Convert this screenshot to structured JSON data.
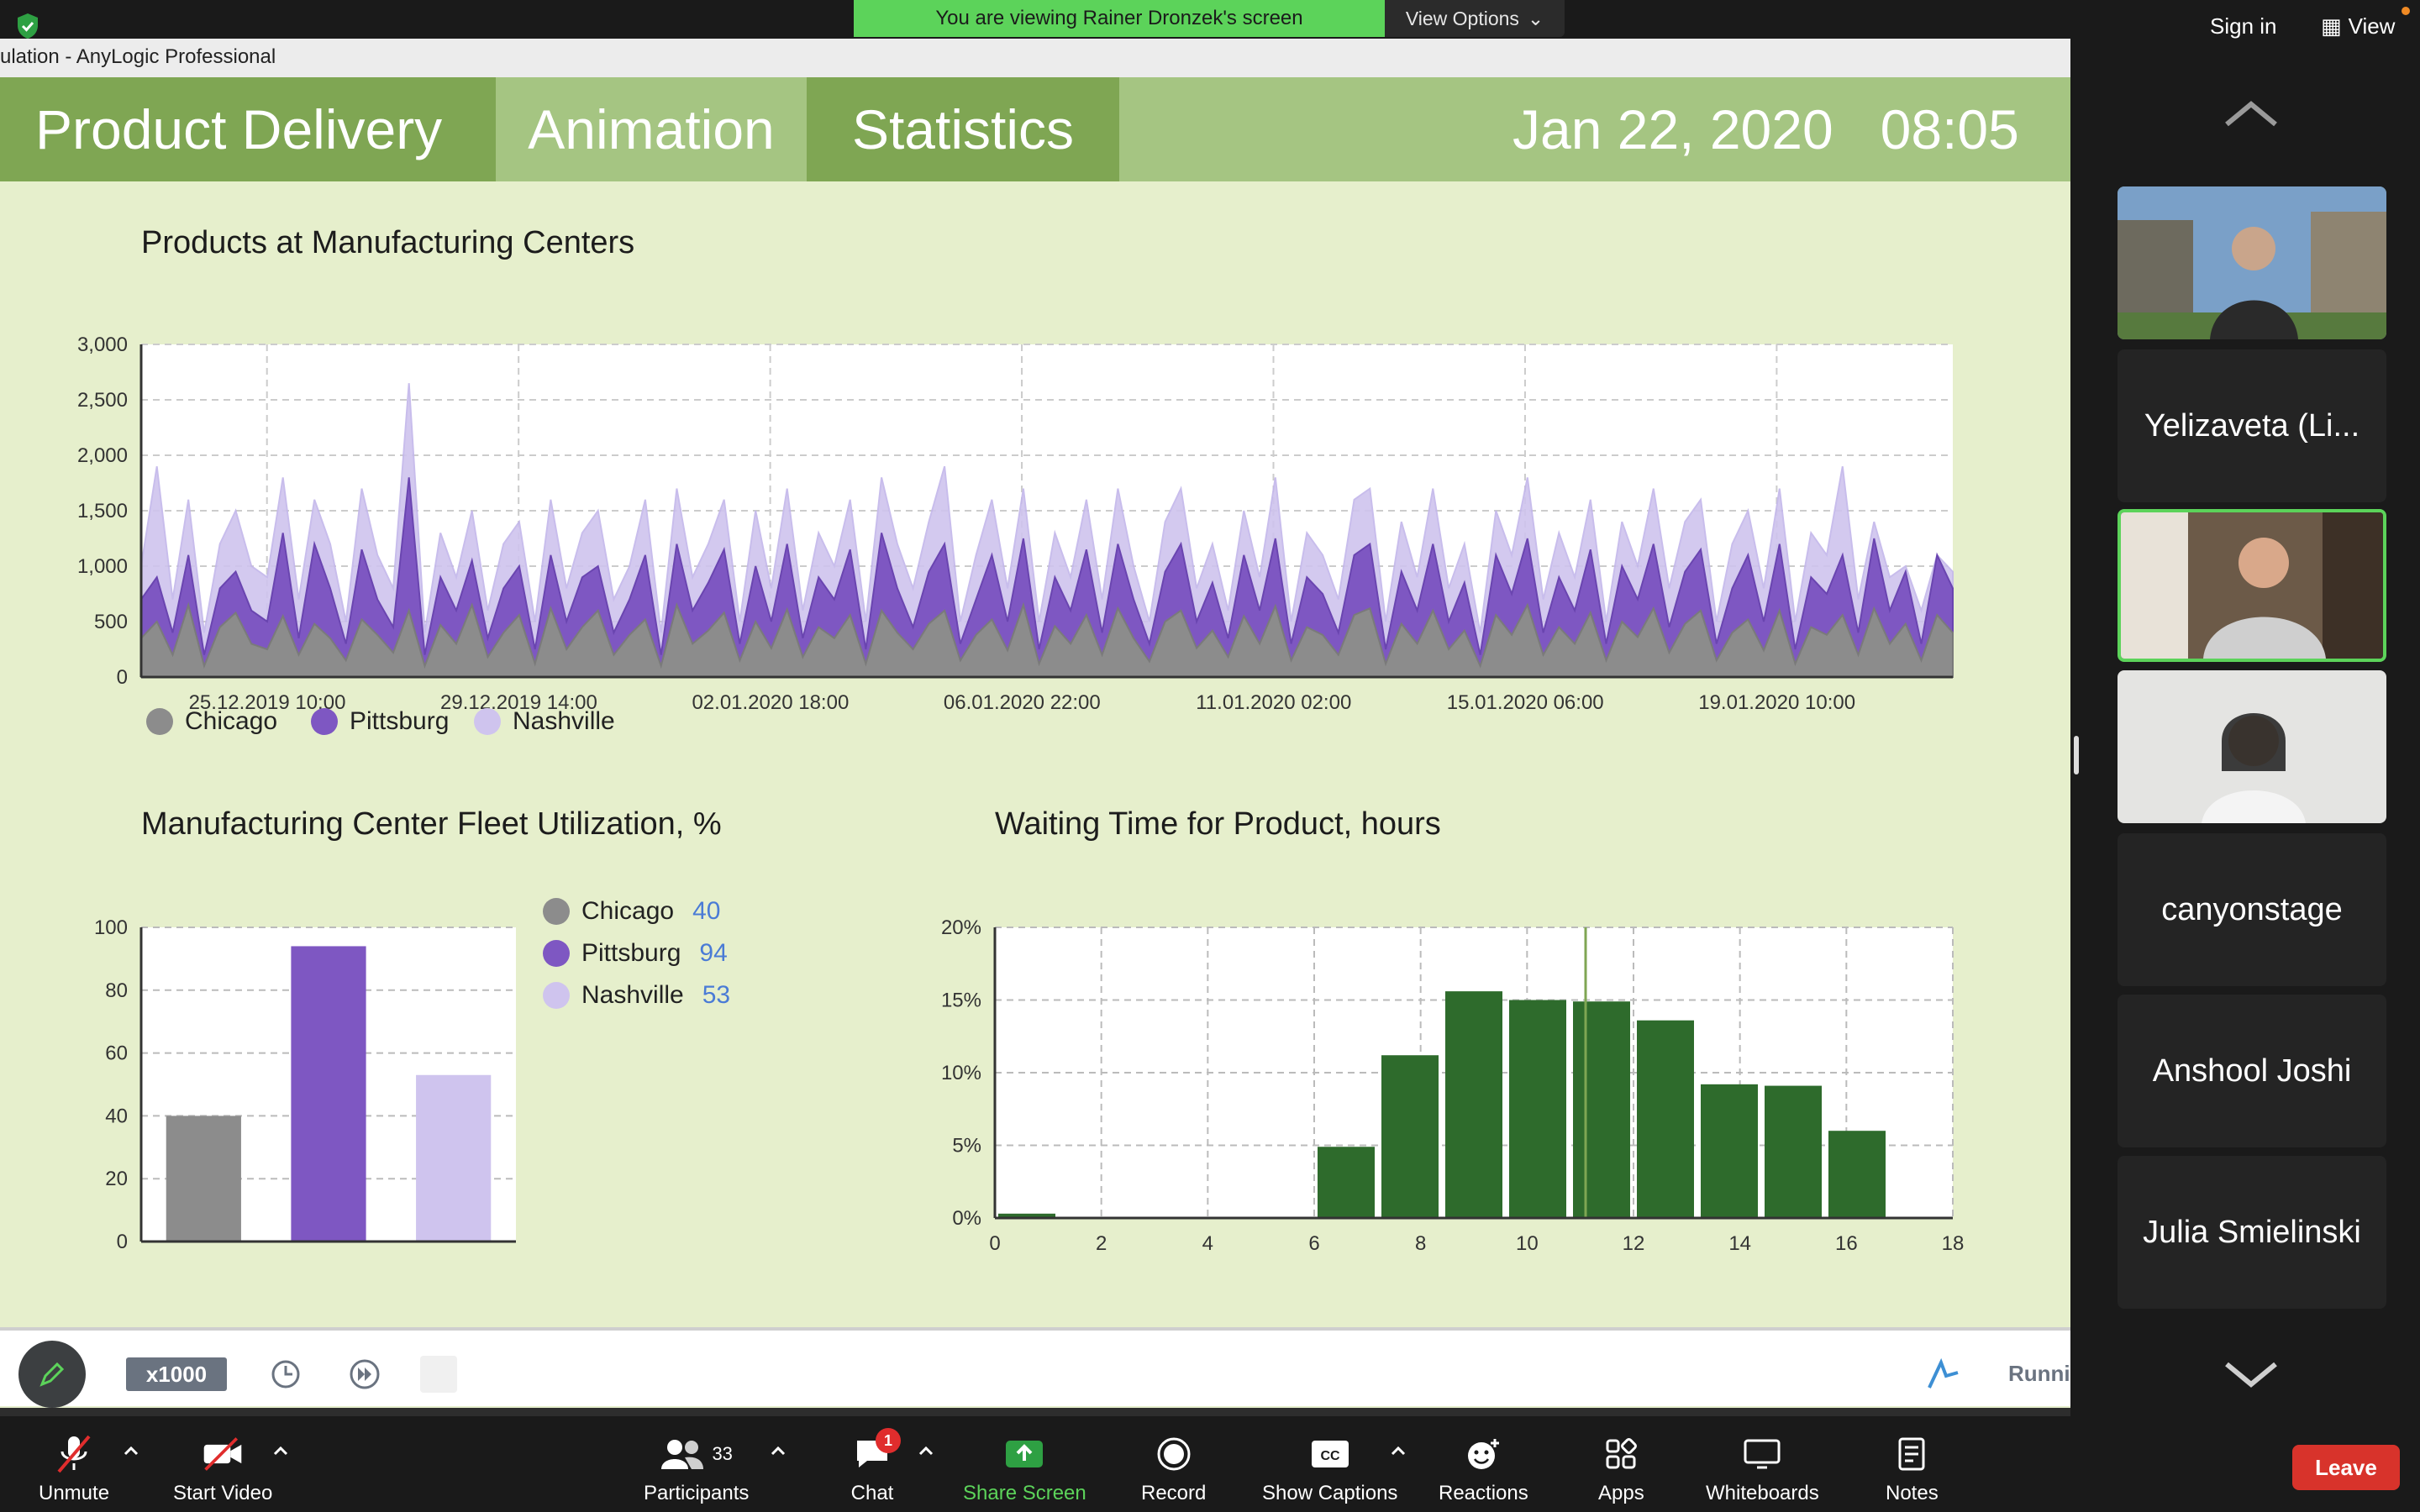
{
  "zoom_top": {
    "banner_text": "You are viewing Rainer Dronzek's screen",
    "view_options_label": "View Options",
    "sign_in_label": "Sign in",
    "view_label": "View"
  },
  "app": {
    "window_title": "ulation - AnyLogic Professional",
    "header": {
      "tabs": [
        "Product Delivery",
        "Animation",
        "Statistics"
      ],
      "date": "Jan 22, 2020",
      "time": "08:05"
    },
    "toolbar": {
      "speed_label": "x1000",
      "status_label": "Runni"
    }
  },
  "chart_data": [
    {
      "type": "area",
      "title": "Products at Manufacturing Centers",
      "xlabel": "",
      "ylabel": "",
      "ylim": [
        0,
        3000
      ],
      "yticks": [
        "0",
        "500",
        "1,000",
        "1,500",
        "2,000",
        "2,500",
        "3,000"
      ],
      "xtick_labels": [
        "25.12.2019 10:00",
        "29.12.2019 14:00",
        "02.01.2020 18:00",
        "06.01.2020 22:00",
        "11.01.2020 02:00",
        "15.01.2020 06:00",
        "19.01.2020 10:00"
      ],
      "grid": true,
      "legend_position": "bottom-left",
      "series": [
        {
          "name": "Chicago",
          "color": "#8c8c8c",
          "values": [
            350,
            500,
            200,
            650,
            100,
            450,
            580,
            300,
            250,
            550,
            200,
            480,
            350,
            150,
            520,
            380,
            220,
            600,
            100,
            470,
            300,
            650,
            180,
            400,
            560,
            120,
            620,
            250,
            450,
            600,
            200,
            380,
            520,
            100,
            650,
            300,
            420,
            580,
            150,
            500,
            260,
            610,
            180,
            450,
            350,
            560,
            120,
            600,
            400,
            250,
            480,
            600,
            150,
            380,
            520,
            240,
            650,
            120,
            460,
            300,
            560,
            200,
            620,
            350,
            140,
            500,
            600,
            260,
            420,
            180,
            550,
            300,
            640,
            150,
            450,
            380,
            200,
            560,
            620,
            120,
            480,
            300,
            600,
            250,
            420,
            100,
            560,
            380,
            650,
            200,
            450,
            300,
            580,
            150,
            500,
            360,
            620,
            220,
            480,
            600,
            150,
            400,
            520,
            240,
            600,
            120,
            450,
            380,
            560,
            200,
            620,
            300,
            480,
            150,
            560,
            400
          ]
        },
        {
          "name": "Pittsburg",
          "color": "#7e57c2",
          "values": [
            700,
            900,
            400,
            1100,
            200,
            800,
            950,
            600,
            500,
            1300,
            350,
            1200,
            800,
            300,
            1150,
            700,
            450,
            1800,
            200,
            900,
            600,
            1050,
            350,
            800,
            1000,
            250,
            1100,
            500,
            900,
            1000,
            400,
            700,
            1100,
            200,
            1200,
            600,
            850,
            1150,
            300,
            1000,
            500,
            1200,
            350,
            900,
            700,
            1150,
            250,
            1300,
            800,
            450,
            950,
            1200,
            300,
            700,
            1100,
            500,
            1250,
            250,
            900,
            600,
            1150,
            400,
            1200,
            700,
            300,
            950,
            1200,
            500,
            850,
            350,
            1100,
            600,
            1250,
            300,
            900,
            750,
            400,
            1100,
            1200,
            250,
            950,
            600,
            1200,
            500,
            850,
            200,
            1100,
            750,
            1250,
            400,
            900,
            600,
            1150,
            300,
            1000,
            700,
            1200,
            450,
            950,
            1150,
            300,
            800,
            1100,
            500,
            1200,
            250,
            900,
            750,
            1100,
            400,
            1250,
            600,
            950,
            300,
            1100,
            800
          ]
        },
        {
          "name": "Nashville",
          "color": "#cfc4ee",
          "values": [
            1000,
            1900,
            700,
            1600,
            400,
            1200,
            1500,
            1000,
            900,
            1800,
            700,
            1600,
            1200,
            500,
            1700,
            1100,
            800,
            2650,
            400,
            1300,
            900,
            1500,
            600,
            1200,
            1400,
            500,
            1600,
            800,
            1300,
            1500,
            700,
            1000,
            1600,
            400,
            1700,
            900,
            1200,
            1600,
            500,
            1500,
            800,
            1700,
            600,
            1300,
            1000,
            1600,
            500,
            1800,
            1200,
            800,
            1400,
            1900,
            500,
            1100,
            1600,
            800,
            1700,
            500,
            1300,
            900,
            1600,
            700,
            1700,
            1000,
            500,
            1400,
            1700,
            800,
            1200,
            600,
            1500,
            900,
            1800,
            500,
            1300,
            1100,
            700,
            1600,
            1700,
            500,
            1400,
            900,
            1700,
            800,
            1200,
            400,
            1500,
            1100,
            1800,
            700,
            1300,
            900,
            1600,
            500,
            1400,
            1000,
            1700,
            800,
            1400,
            1600,
            500,
            1200,
            1500,
            800,
            1700,
            500,
            1300,
            1100,
            1900,
            700,
            1400,
            900,
            1000,
            600,
            1100,
            950
          ]
        }
      ]
    },
    {
      "type": "bar",
      "title": "Manufacturing Center Fleet Utilization, %",
      "xlabel": "",
      "ylabel": "",
      "ylim": [
        0,
        100
      ],
      "yticks": [
        "0",
        "20",
        "40",
        "60",
        "80",
        "100"
      ],
      "categories": [
        "Chicago",
        "Pittsburg",
        "Nashville"
      ],
      "values": [
        40,
        94,
        53
      ],
      "colors": [
        "#8c8c8c",
        "#7e57c2",
        "#cfc4ee"
      ],
      "value_labels": [
        "40",
        "94",
        "53"
      ],
      "grid": true,
      "legend_position": "right"
    },
    {
      "type": "bar",
      "title": "Waiting Time for Product, hours",
      "xlabel": "",
      "ylabel": "",
      "xlim": [
        0,
        18
      ],
      "ylim": [
        0,
        20
      ],
      "yticks": [
        "0%",
        "5%",
        "10%",
        "15%",
        "20%"
      ],
      "xticks": [
        "0",
        "2",
        "4",
        "6",
        "8",
        "10",
        "12",
        "14",
        "16",
        "18"
      ],
      "bins": [
        [
          0,
          1.2
        ],
        [
          6,
          7.2
        ],
        [
          7.2,
          8.4
        ],
        [
          8.4,
          9.6
        ],
        [
          9.6,
          10.8
        ],
        [
          10.8,
          12
        ],
        [
          12,
          13.2
        ],
        [
          13.2,
          14.4
        ],
        [
          14.4,
          15.6
        ],
        [
          15.6,
          16.8
        ]
      ],
      "values": [
        0.3,
        4.9,
        11.2,
        15.6,
        15.0,
        14.9,
        13.6,
        9.2,
        9.1,
        6.0
      ],
      "mean_marker": 11.1,
      "color": "#2e6b2c",
      "grid": true
    }
  ],
  "gallery": {
    "participants": [
      {
        "name": "",
        "type": "video"
      },
      {
        "name": "Yelizaveta (Li...",
        "type": "name"
      },
      {
        "name": "",
        "type": "video",
        "active": true
      },
      {
        "name": "",
        "type": "video"
      },
      {
        "name": "canyonstage",
        "type": "name"
      },
      {
        "name": "Anshool Joshi",
        "type": "name"
      },
      {
        "name": "Julia Smielinski",
        "type": "name"
      }
    ]
  },
  "zoom_bar": {
    "unmute": "Unmute",
    "start_video": "Start Video",
    "participants": "Participants",
    "participants_count": "33",
    "chat": "Chat",
    "chat_badge": "1",
    "share_screen": "Share Screen",
    "record": "Record",
    "show_captions": "Show Captions",
    "reactions": "Reactions",
    "apps": "Apps",
    "whiteboards": "Whiteboards",
    "notes": "Notes",
    "leave": "Leave"
  }
}
